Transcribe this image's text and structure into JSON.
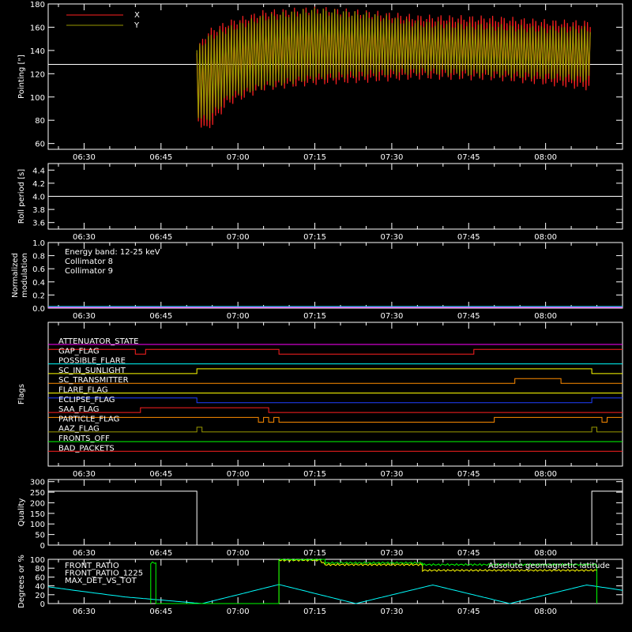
{
  "time_ticks": [
    "06:30",
    "06:45",
    "07:00",
    "07:15",
    "07:30",
    "07:45",
    "08:00"
  ],
  "colors": {
    "x": "#ff2020",
    "y": "#999900",
    "white": "#ffffff",
    "cyan": "#00ffff",
    "magenta": "#ff00ff",
    "green": "#00ff00",
    "yellow": "#ffff00",
    "orange": "#ff8c00"
  },
  "chart_data": [
    {
      "type": "line",
      "ylabel": "Pointing [\"]",
      "ylim": [
        55,
        180
      ],
      "yticks": [
        60,
        80,
        100,
        120,
        140,
        160,
        180
      ],
      "xlim_minutes": [
        -7,
        105
      ],
      "series": [
        {
          "name": "X",
          "color": "#ff2020",
          "upper": [
            [
              22,
              140
            ],
            [
              24,
              155
            ],
            [
              28,
              163
            ],
            [
              35,
              172
            ],
            [
              45,
              175
            ],
            [
              55,
              172
            ],
            [
              65,
              168
            ],
            [
              80,
              167
            ],
            [
              90,
              164
            ],
            [
              99,
              163
            ]
          ],
          "lower": [
            [
              22,
              80
            ],
            [
              24,
              72
            ],
            [
              28,
              95
            ],
            [
              35,
              108
            ],
            [
              45,
              113
            ],
            [
              55,
              115
            ],
            [
              65,
              118
            ],
            [
              80,
              117
            ],
            [
              90,
              113
            ],
            [
              99,
              108
            ]
          ]
        },
        {
          "name": "Y",
          "color": "#999900",
          "upper": [
            [
              22,
              140
            ],
            [
              24,
              150
            ],
            [
              28,
              158
            ],
            [
              35,
              168
            ],
            [
              45,
              174
            ],
            [
              55,
              170
            ],
            [
              65,
              163
            ],
            [
              80,
              160
            ],
            [
              90,
              158
            ],
            [
              99,
              158
            ]
          ],
          "lower": [
            [
              22,
              85
            ],
            [
              24,
              80
            ],
            [
              28,
              100
            ],
            [
              35,
              110
            ],
            [
              45,
              117
            ],
            [
              55,
              120
            ],
            [
              65,
              122
            ],
            [
              80,
              120
            ],
            [
              90,
              118
            ],
            [
              99,
              115
            ]
          ]
        }
      ],
      "reference_line": 128,
      "data_window": [
        22,
        99
      ]
    },
    {
      "type": "line",
      "ylabel": "Roll period [s]",
      "ylim": [
        3.5,
        4.5
      ],
      "yticks": [
        3.6,
        3.8,
        4.0,
        4.2,
        4.4
      ],
      "series": [
        {
          "name": "",
          "color": "#ffffff",
          "x": [
            -7,
            105
          ],
          "y": [
            4.0,
            4.0
          ]
        }
      ]
    },
    {
      "type": "line",
      "ylabel": "Normalized modulation",
      "ylim": [
        0,
        1
      ],
      "yticks": [
        0.0,
        0.2,
        0.4,
        0.6,
        0.8,
        1.0
      ],
      "legend": [
        "Energy band: 12-25 keV",
        "Collimator 8",
        "Collimator 9"
      ],
      "legend_colors": [
        "#ffffff",
        "#00ffff",
        "#ff00ff"
      ],
      "series": [
        {
          "name": "Collimator 8",
          "color": "#00ffff",
          "x": [
            -7,
            105
          ],
          "y": [
            0.0,
            0.0
          ]
        },
        {
          "name": "Collimator 9",
          "color": "#ff00ff",
          "x": [
            -7,
            105
          ],
          "y": [
            0.0,
            0.0
          ]
        }
      ]
    },
    {
      "type": "line",
      "ylabel": "Flags",
      "flags": [
        {
          "name": "ATTENUATOR_STATE",
          "color": "#ff00ff",
          "steps": [
            [
              -7,
              0
            ],
            [
              105,
              0
            ]
          ]
        },
        {
          "name": "GAP_FLAG",
          "color": "#ff2020",
          "steps": [
            [
              -7,
              1
            ],
            [
              10,
              0
            ],
            [
              12,
              1
            ],
            [
              38,
              0
            ],
            [
              76,
              1
            ],
            [
              105,
              1
            ]
          ]
        },
        {
          "name": "POSSIBLE_FLARE",
          "color": "#00ffff",
          "steps": [
            [
              -7,
              0
            ],
            [
              105,
              0
            ]
          ]
        },
        {
          "name": "SC_IN_SUNLIGHT",
          "color": "#ffff00",
          "steps": [
            [
              -7,
              0
            ],
            [
              22,
              1
            ],
            [
              99,
              0
            ],
            [
              105,
              0
            ]
          ]
        },
        {
          "name": "SC_TRANSMITTER",
          "color": "#ff8c00",
          "steps": [
            [
              -7,
              0
            ],
            [
              84,
              1
            ],
            [
              93,
              0
            ],
            [
              105,
              0
            ]
          ]
        },
        {
          "name": "FLARE_FLAG",
          "color": "#ffff00",
          "steps": [
            [
              -7,
              0
            ],
            [
              105,
              0
            ]
          ]
        },
        {
          "name": "ECLIPSE_FLAG",
          "color": "#2040ff",
          "steps": [
            [
              -7,
              1
            ],
            [
              22,
              0
            ],
            [
              99,
              1
            ],
            [
              105,
              1
            ]
          ]
        },
        {
          "name": "SAA_FLAG",
          "color": "#ff2020",
          "steps": [
            [
              -7,
              0
            ],
            [
              11,
              1
            ],
            [
              36,
              0
            ],
            [
              105,
              0
            ]
          ]
        },
        {
          "name": "PARTICLE_FLAG",
          "color": "#ff8c00",
          "steps": [
            [
              -7,
              1
            ],
            [
              34,
              0
            ],
            [
              35,
              1
            ],
            [
              36,
              0
            ],
            [
              37,
              1
            ],
            [
              38,
              0
            ],
            [
              80,
              1
            ],
            [
              101,
              0
            ],
            [
              102,
              1
            ],
            [
              105,
              1
            ]
          ]
        },
        {
          "name": "AAZ_FLAG",
          "color": "#999900",
          "steps": [
            [
              -7,
              0
            ],
            [
              22,
              1
            ],
            [
              23,
              0
            ],
            [
              99,
              1
            ],
            [
              100,
              0
            ],
            [
              105,
              0
            ]
          ]
        },
        {
          "name": "FRONTS_OFF",
          "color": "#00ff00",
          "steps": [
            [
              -7,
              0
            ],
            [
              105,
              0
            ]
          ]
        },
        {
          "name": "BAD_PACKETS",
          "color": "#ff2020",
          "steps": [
            [
              -7,
              0
            ],
            [
              105,
              0
            ]
          ]
        }
      ]
    },
    {
      "type": "line",
      "ylabel": "Quality",
      "ylim": [
        0,
        310
      ],
      "yticks": [
        0,
        50,
        100,
        150,
        200,
        250,
        300
      ],
      "series": [
        {
          "name": "",
          "color": "#ffffff",
          "steps": [
            [
              -7,
              255
            ],
            [
              22,
              0
            ],
            [
              99,
              255
            ],
            [
              105,
              255
            ]
          ]
        }
      ]
    },
    {
      "type": "line",
      "ylabel": "Degrees or %",
      "ylim": [
        0,
        100
      ],
      "yticks": [
        0,
        20,
        40,
        60,
        80,
        100
      ],
      "legend": [
        "FRONT_RATIO",
        "FRONT_RATIO_1225",
        "MAX_DET_VS_TOT"
      ],
      "legend_colors": [
        "#ffff00",
        "#00ff00",
        "#ff8c00"
      ],
      "annotation": "Absolute geomagnetic latitude",
      "annotation_color": "#00ffff",
      "series": [
        {
          "name": "Absolute geomagnetic latitude",
          "color": "#00ffff",
          "x": [
            -7,
            -2,
            8,
            23,
            38,
            53,
            68,
            83,
            98,
            105
          ],
          "y": [
            38,
            30,
            15,
            0,
            43,
            0,
            42,
            0,
            42,
            30
          ]
        },
        {
          "name": "FRONT_RATIO",
          "color": "#ffff00",
          "x": [
            38,
            38,
            46,
            47,
            66,
            66,
            100,
            100
          ],
          "y": [
            0,
            98,
            98,
            88,
            88,
            75,
            75,
            0
          ]
        },
        {
          "name": "FRONT_RATIO_1225",
          "color": "#00ff00",
          "x": [
            13,
            13,
            14,
            14,
            38,
            38,
            47,
            47,
            66,
            66,
            100,
            100
          ],
          "y": [
            0,
            92,
            92,
            0,
            0,
            100,
            100,
            92,
            92,
            88,
            88,
            0
          ]
        }
      ]
    }
  ]
}
